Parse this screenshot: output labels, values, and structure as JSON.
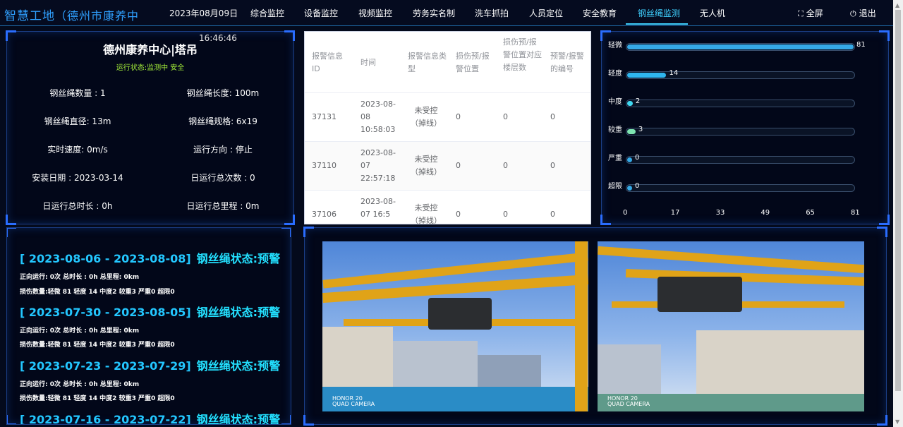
{
  "header": {
    "brand": "智慧工地",
    "project": "（德州市康养中",
    "date": "2023年08月09日",
    "nav": [
      "综合监控",
      "设备监控",
      "视频监控",
      "劳务实名制",
      "洗车抓拍",
      "人员定位",
      "安全教育",
      "钢丝绳监测",
      "无人机"
    ],
    "active_nav": "钢丝绳监测",
    "fullscreen": "全屏",
    "logout": "退出"
  },
  "info": {
    "title": "德州康养中心|塔吊",
    "time": "16:46:46",
    "status": "运行状态:监测中 安全",
    "fields": [
      "钢丝绳数量 : 1",
      "钢丝绳长度: 100m",
      "钢丝绳直径: 13m",
      "钢丝绳规格: 6x19",
      "实时速度: 0m/s",
      "运行方向 : 停止",
      "安装日期 : 2023-03-14",
      "日运行总次数 : 0",
      "日运行总时长 : 0h",
      "日运行总里程 : 0m"
    ]
  },
  "table": {
    "columns": [
      "报警信息ID",
      "时间",
      "报警信息类型",
      "损伤预/报警位置",
      "损伤预/报警位置对应楼层数",
      "预警/报警的编号"
    ],
    "rows": [
      [
        "37131",
        "2023-08-08 10:58:03",
        "未受控（掉线）",
        "0",
        "0",
        "0"
      ],
      [
        "37110",
        "2023-08-07 22:57:18",
        "未受控（掉线）",
        "0",
        "0",
        "0"
      ],
      [
        "37106",
        "2023-08-07 16:5",
        "未受控（掉线）",
        "0",
        "0",
        "0"
      ]
    ]
  },
  "chart_data": {
    "type": "bar",
    "orientation": "horizontal",
    "categories": [
      "轻微",
      "轻度",
      "中度",
      "较重",
      "严重",
      "超限"
    ],
    "values": [
      81,
      14,
      2,
      3,
      0,
      0
    ],
    "colors": [
      "#35a9e6",
      "#2fb6ee",
      "#3fd7f0",
      "#7de3b0",
      "#35a9e6",
      "#35a9e6"
    ],
    "xticks": [
      "0",
      "17",
      "33",
      "49",
      "65",
      "81"
    ],
    "xlim": [
      0,
      81
    ]
  },
  "weeks": [
    {
      "range": "[ 2023-08-06 - 2023-08-08]",
      "state": "钢丝绳状态:预警",
      "line1": "正向运行: 0次 总时长 : 0h 总里程: 0km",
      "line2": "损伤数量:轻微 81 轻度 14 中度2 较重3 严重0 超限0"
    },
    {
      "range": "[ 2023-07-30 - 2023-08-05]",
      "state": "钢丝绳状态:预警",
      "line1": "正向运行: 0次 总时长 : 0h 总里程: 0km",
      "line2": "损伤数量:轻微 81 轻度 14 中度2 较重3 严重0 超限0"
    },
    {
      "range": "[ 2023-07-23 - 2023-07-29]",
      "state": "钢丝绳状态:预警",
      "line1": "正向运行: 0次 总时长 : 0h 总里程: 0km",
      "line2": "损伤数量:轻微 81 轻度 14 中度2 较重3 严重0 超限0"
    },
    {
      "range": "[ 2023-07-16 - 2023-07-22]",
      "state": "钢丝绳状态:预警"
    }
  ],
  "photos": {
    "watermark": [
      "HONOR 20",
      "QUAD CAMERA"
    ]
  }
}
